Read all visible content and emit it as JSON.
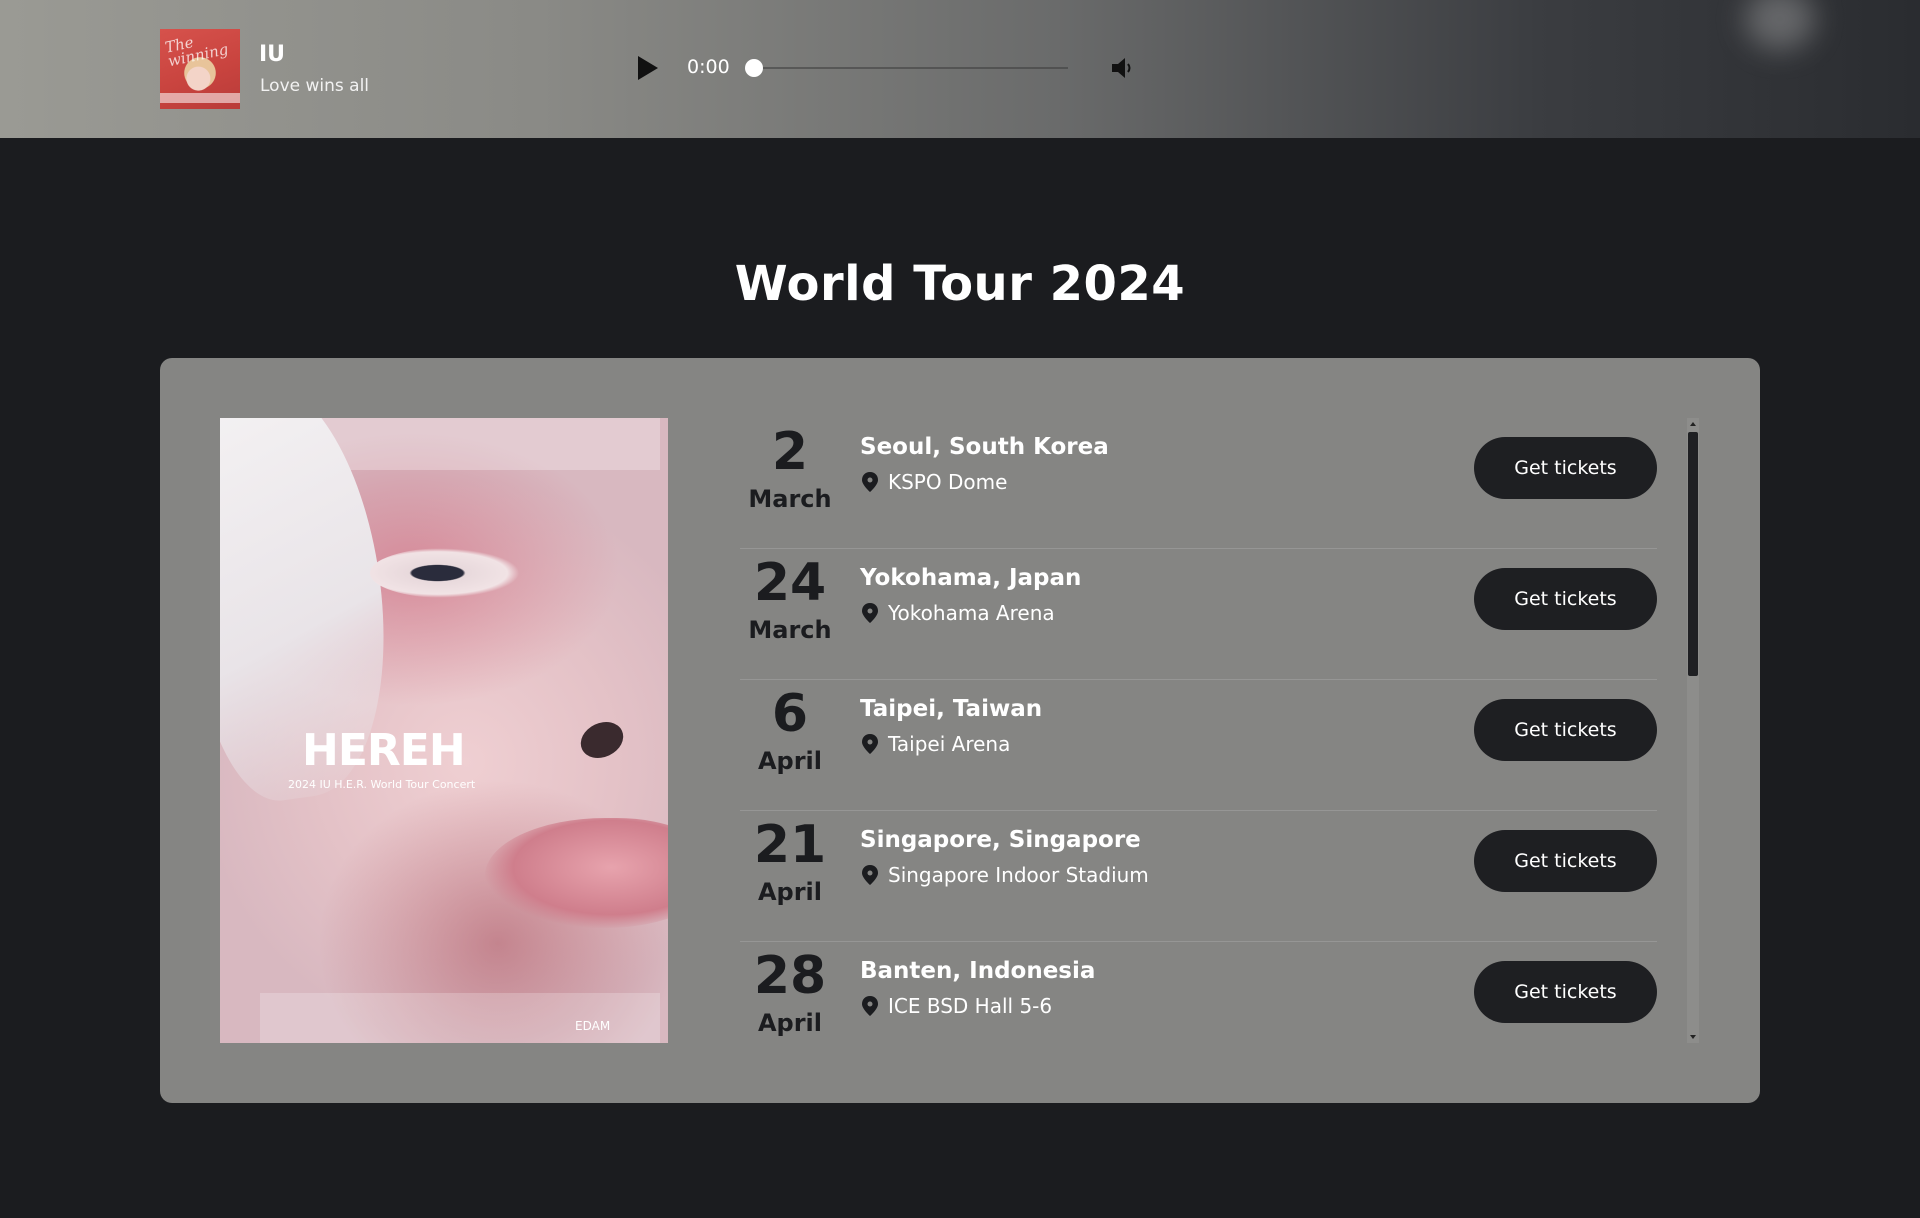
{
  "player": {
    "track_title": "IU",
    "track_artist": "Love wins all",
    "current_time": "0:00",
    "progress": 0,
    "cover_script": "The winning",
    "icons": {
      "play": "play-icon",
      "volume": "volume-icon"
    }
  },
  "page": {
    "heading": "World Tour 2024"
  },
  "poster": {
    "title": "HEREH",
    "subtitle": "2024 IU H.E.R. World Tour Concert",
    "brand": "EDAM"
  },
  "tour": {
    "button_label": "Get tickets",
    "dates": [
      {
        "day": "2",
        "month": "March",
        "city": "Seoul, South Korea",
        "venue": "KSPO Dome"
      },
      {
        "day": "24",
        "month": "March",
        "city": "Yokohama, Japan",
        "venue": "Yokohama Arena"
      },
      {
        "day": "6",
        "month": "April",
        "city": "Taipei, Taiwan",
        "venue": "Taipei Arena"
      },
      {
        "day": "21",
        "month": "April",
        "city": "Singapore, Singapore",
        "venue": "Singapore Indoor Stadium"
      },
      {
        "day": "28",
        "month": "April",
        "city": "Banten, Indonesia",
        "venue": "ICE BSD Hall 5-6"
      }
    ]
  },
  "colors": {
    "page_background": "#1b1c1f",
    "card_background": "#858583",
    "button_background": "#1e1f22",
    "date_text": "#1b1c1f"
  }
}
